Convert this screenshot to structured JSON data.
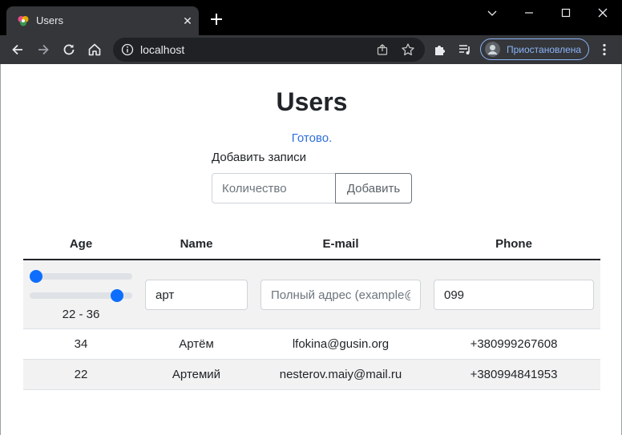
{
  "browser": {
    "tab_title": "Users",
    "url": "localhost",
    "profile_label": "Приостановлена"
  },
  "page": {
    "title": "Users",
    "status": "Готово.",
    "add_label": "Добавить записи",
    "count_placeholder": "Количество",
    "add_button": "Добавить"
  },
  "table": {
    "headers": {
      "age": "Age",
      "name": "Name",
      "email": "E-mail",
      "phone": "Phone"
    },
    "filters": {
      "age_min_fraction": 0.0,
      "age_max_fraction": 0.9,
      "age_range_label": "22 - 36",
      "name_value": "арт",
      "email_placeholder": "Полный адрес (example@mail.com)",
      "phone_value": "099"
    },
    "rows": [
      {
        "age": "34",
        "name": "Артём",
        "email": "lfokina@gusin.org",
        "phone": "+380999267608"
      },
      {
        "age": "22",
        "name": "Артемий",
        "email": "nesterov.maiy@mail.ru",
        "phone": "+380994841953"
      }
    ]
  },
  "colors": {
    "accent": "#0d6efd",
    "status_link": "#2f6fdc",
    "profile_border": "#8ab4f8"
  }
}
